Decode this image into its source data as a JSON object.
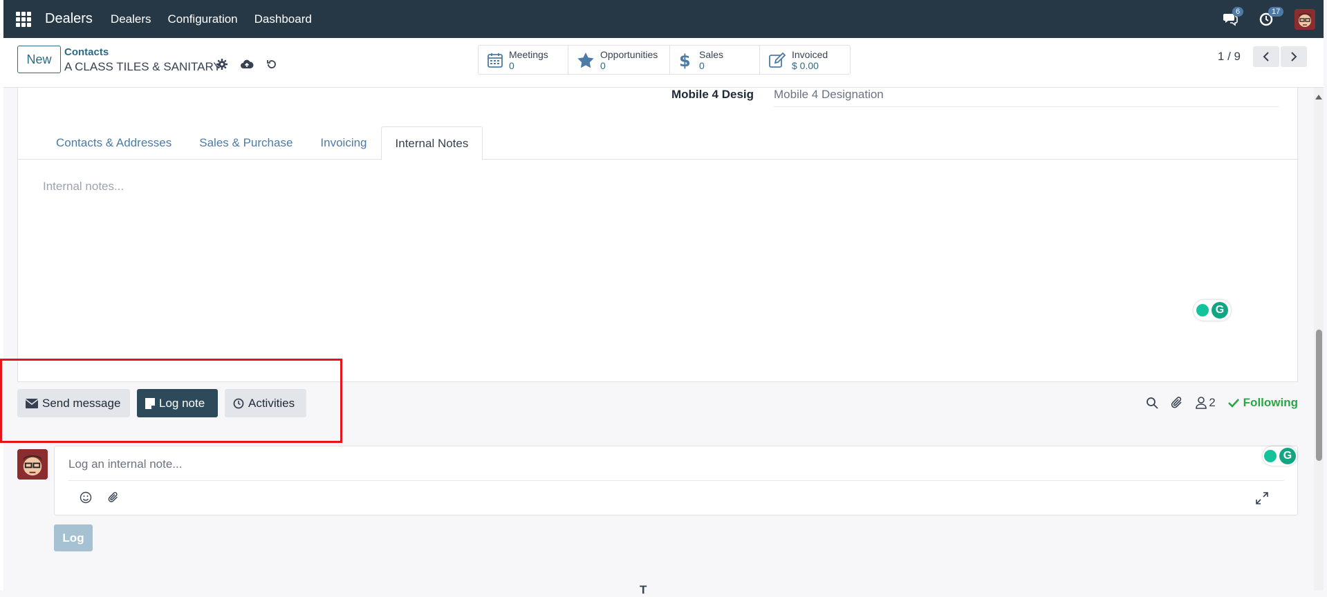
{
  "topbar": {
    "app_name": "Dealers",
    "menus": [
      "Dealers",
      "Configuration",
      "Dashboard"
    ],
    "messages_count": "6",
    "activities_count": "17",
    "icons": [
      "apps-icon",
      "chat-icon",
      "clock-icon",
      "user-avatar"
    ]
  },
  "control_panel": {
    "new_label": "New",
    "breadcrumb": "Contacts",
    "record_title": "A CLASS TILES & SANITARY",
    "smart_buttons": [
      {
        "icon": "calendar-icon",
        "label": "Meetings",
        "value": "0"
      },
      {
        "icon": "star-icon",
        "label": "Opportunities",
        "value": "0"
      },
      {
        "icon": "dollar-icon",
        "label": "Sales",
        "value": "0"
      },
      {
        "icon": "edit-icon",
        "label": "Invoiced",
        "value": "$ 0.00"
      }
    ],
    "pager": "1 / 9"
  },
  "form": {
    "field_label": "Mobile 4 Desig",
    "field_placeholder": "Mobile 4 Designation",
    "tabs": [
      "Contacts & Addresses",
      "Sales & Purchase",
      "Invoicing",
      "Internal Notes"
    ],
    "active_tab": "Internal Notes",
    "notes_placeholder": "Internal notes..."
  },
  "chatter": {
    "send_message": "Send message",
    "log_note": "Log note",
    "activities": "Activities",
    "followers_count": "2",
    "following_label": "Following",
    "composer_placeholder": "Log an internal note...",
    "log_button": "Log",
    "bottom_fragment": "T"
  },
  "colors": {
    "topbar": "#263846",
    "accent": "#2d6a83",
    "link": "#4b7ba6",
    "following": "#28a745",
    "highlight": "#e8121a"
  }
}
